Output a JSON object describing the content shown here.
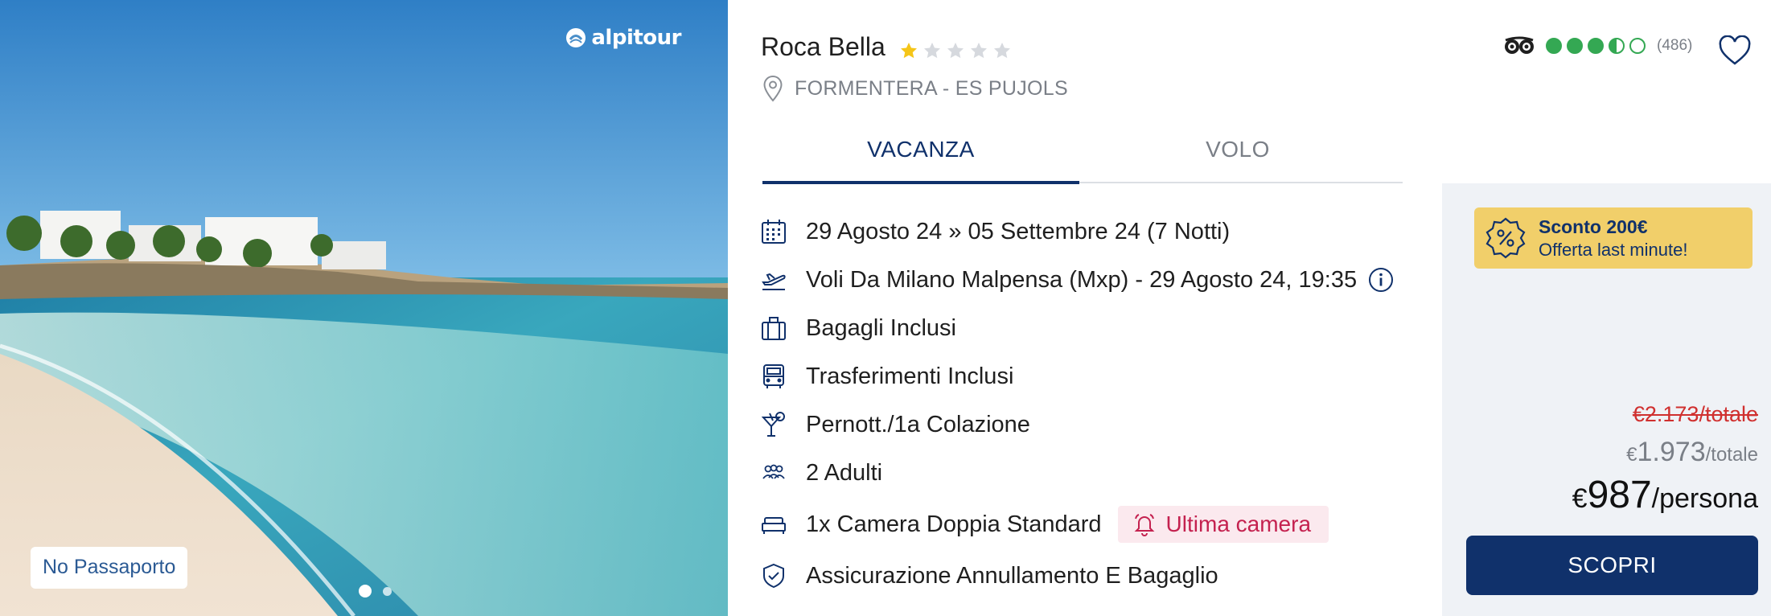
{
  "brand": {
    "name": "alpitour"
  },
  "image": {
    "badge": "No Passaporto",
    "carousel_dots": 2,
    "active_dot": 1
  },
  "hotel": {
    "name": "Roca Bella",
    "stars": {
      "filled": 1,
      "total": 5
    },
    "location": "FORMENTERA - ES PUJOLS"
  },
  "rating": {
    "icon": "tripadvisor-owl-icon",
    "bubbles": 3.5,
    "bubbles_total": 5,
    "count": "(486)"
  },
  "tabs": [
    {
      "label": "VACANZA",
      "active": true
    },
    {
      "label": "VOLO",
      "active": false
    }
  ],
  "details": [
    {
      "icon": "calendar-icon",
      "text": "29 Agosto 24 » 05 Settembre 24 (7 Notti)"
    },
    {
      "icon": "plane-departure-icon",
      "text": "Voli Da Milano Malpensa (Mxp) - 29 Agosto 24, 19:35",
      "info_icon": "info-icon"
    },
    {
      "icon": "luggage-icon",
      "text": "Bagagli Inclusi"
    },
    {
      "icon": "bus-icon",
      "text": "Trasferimenti Inclusi"
    },
    {
      "icon": "cocktail-icon",
      "text": "Pernott./1a Colazione"
    },
    {
      "icon": "people-icon",
      "text": "2 Adulti"
    },
    {
      "icon": "bed-icon",
      "text": "1x Camera Doppia Standard",
      "tag": {
        "icon": "bell-icon",
        "label": "Ultima camera"
      }
    },
    {
      "icon": "shield-check-icon",
      "text": "Assicurazione Annullamento E Bagaglio"
    }
  ],
  "promo": {
    "icon": "discount-badge-icon",
    "title": "Sconto 200€",
    "subtitle": "Offerta last minute!"
  },
  "prices": {
    "old_total": "€2.173/totale",
    "total_currency": "€",
    "total_value": "1.973",
    "total_suffix": "/totale",
    "per_person_currency": "€",
    "per_person_value": "987",
    "per_person_suffix": "/persona"
  },
  "cta": {
    "label": "SCOPRI"
  },
  "colors": {
    "navy": "#10316b",
    "promo_yellow": "#f1cf6a",
    "strike_red": "#d0302f",
    "tripadvisor_green": "#34a853",
    "last_room_bg": "#fbe9ee",
    "last_room_text": "#c4214f",
    "star_gold": "#f5c518"
  }
}
